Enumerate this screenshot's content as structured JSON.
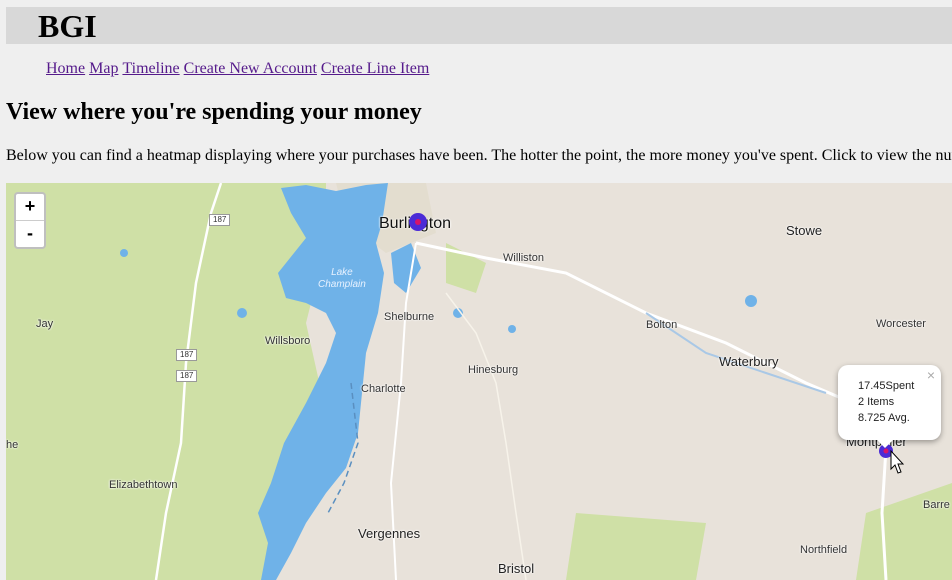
{
  "header": {
    "brand": "BGI"
  },
  "nav": {
    "home": "Home",
    "map": "Map",
    "timeline": "Timeline",
    "create_account": "Create New Account",
    "create_line_item": "Create Line Item"
  },
  "page": {
    "heading": "View where you're spending your money",
    "description": "Below you can find a heatmap displaying where your purchases have been. The hotter the point, the more money you've spent. Click to view the numl"
  },
  "map": {
    "zoom_in": "+",
    "zoom_out": "-",
    "labels": {
      "burlington": "Burlington",
      "stowe": "Stowe",
      "williston": "Williston",
      "lake": "Lake\nChamplain",
      "shelburne": "Shelburne",
      "bolton": "Bolton",
      "worcester": "Worcester",
      "jay": "Jay",
      "willsboro": "Willsboro",
      "waterbury": "Waterbury",
      "hinesburg": "Hinesburg",
      "charlotte": "Charlotte",
      "elizabethtown": "Elizabethtown",
      "montpelier": "Montpelier",
      "barre": "Barre",
      "vergennes": "Vergennes",
      "northfield": "Northfield",
      "bristol": "Bristol",
      "edge_left": "he"
    },
    "shields": {
      "r187a": "187",
      "r187b": "187",
      "r187c": "187"
    },
    "popup": {
      "spent": "17.45Spent",
      "items": "2 Items",
      "avg": "8.725 Avg.",
      "close": "×"
    },
    "colors": {
      "land": "#e8e2da",
      "forest": "#cfe0a6",
      "water": "#6fb2e8",
      "marker": "#4b2bd6"
    }
  }
}
